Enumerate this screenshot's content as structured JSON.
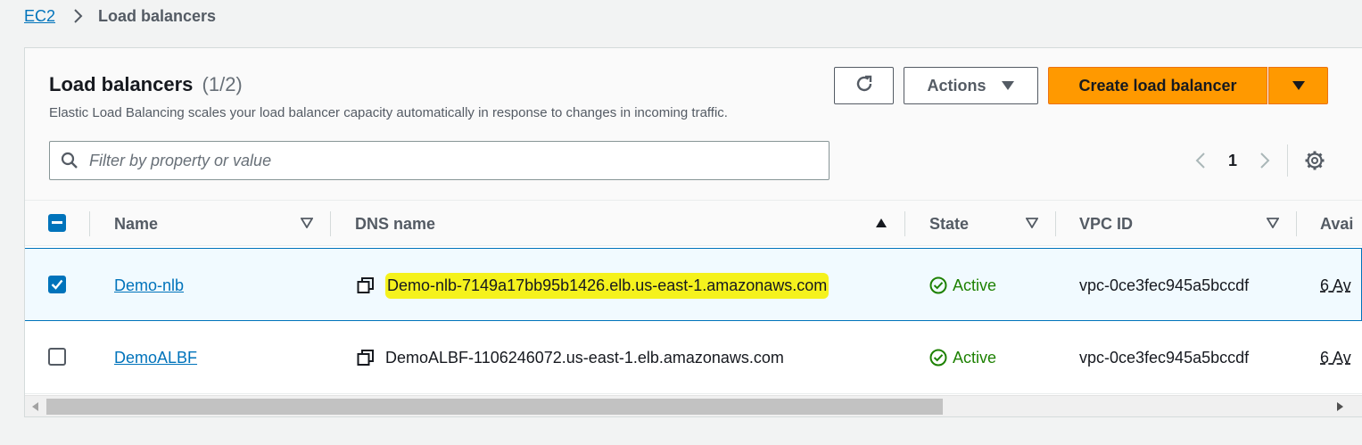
{
  "breadcrumb": {
    "root": "EC2",
    "current": "Load balancers"
  },
  "header": {
    "title": "Load balancers",
    "count": "(1/2)",
    "description": "Elastic Load Balancing scales your load balancer capacity automatically in response to changes in incoming traffic.",
    "actions_label": "Actions",
    "create_label": "Create load balancer"
  },
  "search": {
    "placeholder": "Filter by property or value",
    "value": ""
  },
  "pagination": {
    "current_page": "1"
  },
  "columns": [
    "Name",
    "DNS name",
    "State",
    "VPC ID",
    "Avai"
  ],
  "rows": [
    {
      "selected": true,
      "name": "Demo-nlb",
      "dns": "Demo-nlb-7149a17bb95b1426.elb.us-east-1.amazonaws.com",
      "state": "Active",
      "vpc": "vpc-0ce3fec945a5bccdf",
      "az": "6 Av"
    },
    {
      "selected": false,
      "name": "DemoALBF",
      "dns": "DemoALBF-1106246072.us-east-1.elb.amazonaws.com",
      "state": "Active",
      "vpc": "vpc-0ce3fec945a5bccdf",
      "az": "6 Av"
    }
  ],
  "colors": {
    "accent_orange": "#ff9900",
    "link_blue": "#0073bb",
    "active_green": "#1d8102",
    "highlight_yellow": "#f5f21d"
  }
}
